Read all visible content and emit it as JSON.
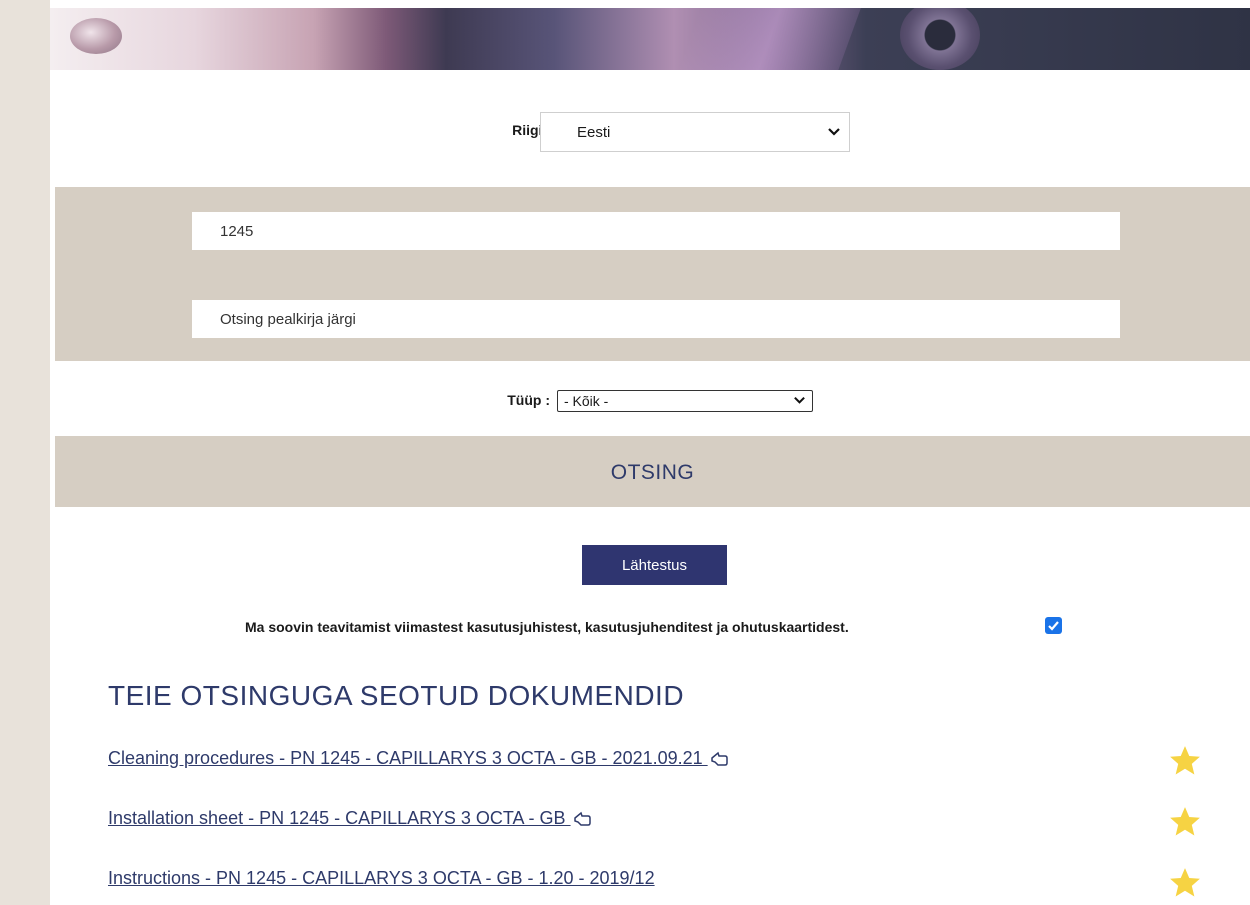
{
  "country": {
    "label": "Riigi valik :",
    "selected": "Eesti"
  },
  "search": {
    "part_number": "1245",
    "title_placeholder": "Otsing pealkirja järgi"
  },
  "type_filter": {
    "label": "Tüüp :",
    "selected": "- Kõik -"
  },
  "search_button_label": "OTSING",
  "reset_button_label": "Lähtestus",
  "notify": {
    "text": "Ma soovin teavitamist viimastest kasutusjuhistest, kasutusjuhenditest ja ohutuskaartidest.",
    "checked": true
  },
  "results": {
    "title": "TEIE OTSINGUGA SEOTUD DOKUMENDID",
    "items": [
      {
        "label": "Cleaning procedures - PN 1245 - CAPILLARYS 3 OCTA - GB - 2021.09.21 "
      },
      {
        "label": "Installation sheet - PN 1245 - CAPILLARYS 3 OCTA - GB "
      },
      {
        "label": "Instructions - PN 1245 - CAPILLARYS 3 OCTA - GB - 1.20 - 2019/12"
      }
    ]
  },
  "colors": {
    "brand_navy": "#2f3570",
    "band_beige": "#d6cec3",
    "star_yellow": "#f6d343",
    "link_blue": "#2e3a6a"
  }
}
